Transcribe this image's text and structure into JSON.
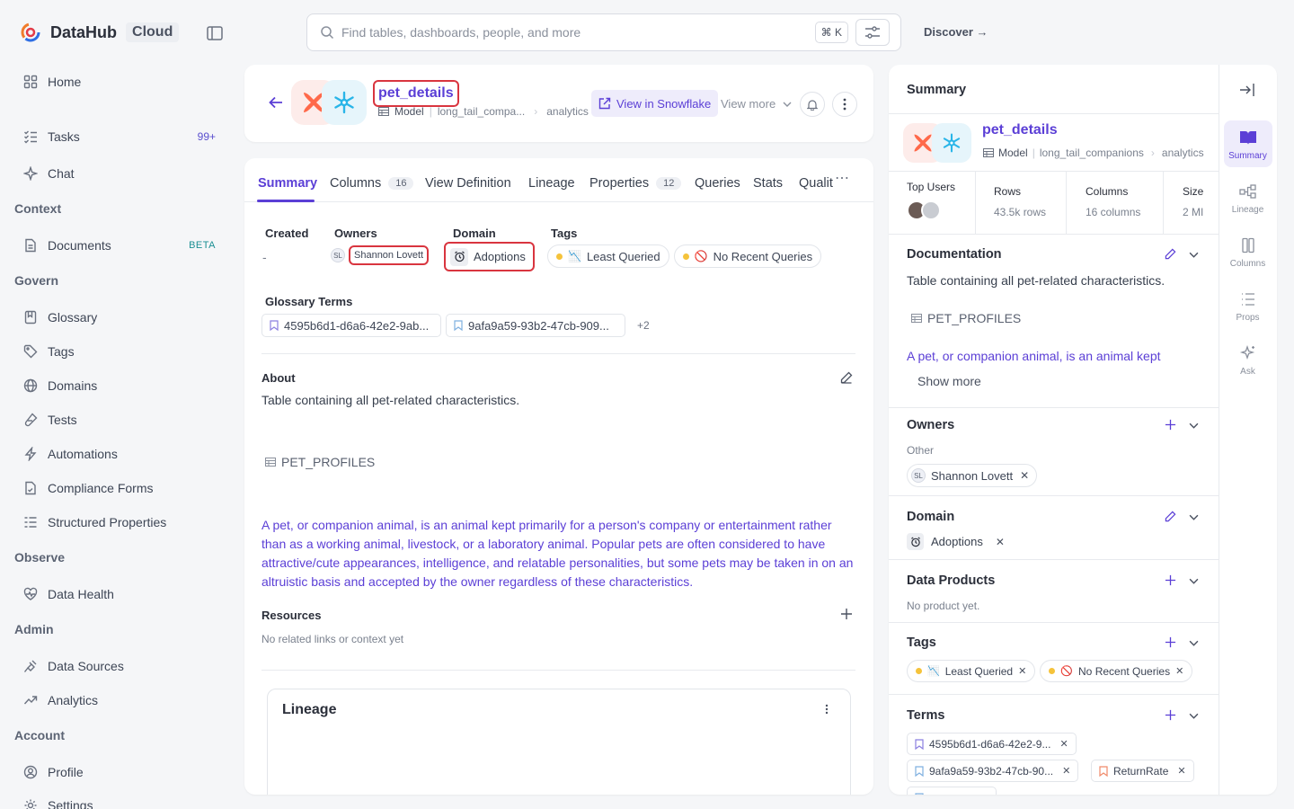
{
  "app": {
    "brand": "DataHub",
    "edition": "Cloud"
  },
  "search": {
    "placeholder": "Find tables, dashboards, people, and more",
    "shortcut": "⌘ K"
  },
  "topbar": {
    "discover": "Discover →"
  },
  "sidebar": {
    "home": "Home",
    "tasks": "Tasks",
    "tasks_badge": "99+",
    "chat": "Chat",
    "section_context": "Context",
    "documents": "Documents",
    "documents_badge": "BETA",
    "section_govern": "Govern",
    "glossary": "Glossary",
    "tags": "Tags",
    "domains": "Domains",
    "tests": "Tests",
    "automations": "Automations",
    "compliance": "Compliance Forms",
    "structured": "Structured Properties",
    "section_observe": "Observe",
    "data_health": "Data Health",
    "section_admin": "Admin",
    "data_sources": "Data Sources",
    "analytics": "Analytics",
    "section_account": "Account",
    "profile": "Profile",
    "settings": "Settings"
  },
  "entity": {
    "name": "pet_details",
    "type": "Model",
    "path1": "long_tail_compa...",
    "path2": "analytics",
    "view_in": "View in Snowflake",
    "view_more": "View more"
  },
  "tabs": [
    {
      "label": "Summary"
    },
    {
      "label": "Columns",
      "count": "16"
    },
    {
      "label": "View Definition"
    },
    {
      "label": "Lineage"
    },
    {
      "label": "Properties",
      "count": "12"
    },
    {
      "label": "Queries"
    },
    {
      "label": "Stats"
    },
    {
      "label": "Qualit"
    }
  ],
  "summary": {
    "created_label": "Created",
    "created_value": "-",
    "owners_label": "Owners",
    "owner_initials": "SL",
    "owner_name": "Shannon Lovett",
    "domain_label": "Domain",
    "domain_value": "Adoptions",
    "tags_label": "Tags",
    "tag1": "Least Queried",
    "tag2": "No Recent Queries",
    "glossary_label": "Glossary Terms",
    "term1": "4595b6d1-d6a6-42e2-9ab...",
    "term2": "9afa9a59-93b2-47cb-909...",
    "term_more": "+2",
    "about_label": "About",
    "about_text": "Table containing all pet-related characteristics.",
    "about_table": "PET_PROFILES",
    "about_desc": "A pet, or companion animal, is an animal kept primarily for a person's company or entertainment rather than as a working animal, livestock, or a laboratory animal. Popular pets are often considered to have attractive/cute appearances, intelligence, and relatable personalities, but some pets may be taken in on an altruistic basis and accepted by the owner regardless of these characteristics.",
    "resources_label": "Resources",
    "resources_empty": "No related links or context yet",
    "lineage_title": "Lineage"
  },
  "panel": {
    "title": "Summary",
    "name": "pet_details",
    "type": "Model",
    "path1": "long_tail_companions",
    "path2": "analytics",
    "top_users": "Top Users",
    "rows_label": "Rows",
    "rows_value": "43.5k rows",
    "columns_label": "Columns",
    "columns_value": "16 columns",
    "size_label": "Size",
    "size_value": "2 MI",
    "doc_title": "Documentation",
    "doc_text": "Table containing all pet-related characteristics.",
    "doc_table": "PET_PROFILES",
    "doc_link": "A pet, or companion animal, is an animal kept",
    "show_more": "Show more",
    "owners_title": "Owners",
    "owners_sub": "Other",
    "owner_initials": "SL",
    "owner_name": "Shannon Lovett",
    "domain_title": "Domain",
    "domain_value": "Adoptions",
    "dp_title": "Data Products",
    "dp_empty": "No product yet.",
    "tags_title": "Tags",
    "tag1": "Least Queried",
    "tag2": "No Recent Queries",
    "terms_title": "Terms",
    "term1": "4595b6d1-d6a6-42e2-9...",
    "term2": "9afa9a59-93b2-47cb-90...",
    "term3": "ReturnRate"
  },
  "rail": {
    "summary": "Summary",
    "lineage": "Lineage",
    "columns": "Columns",
    "props": "Props",
    "ask": "Ask"
  },
  "colors": {
    "accent": "#5b3fd6",
    "highlight": "#d9353f",
    "tag_dot": "#f5c33b"
  }
}
